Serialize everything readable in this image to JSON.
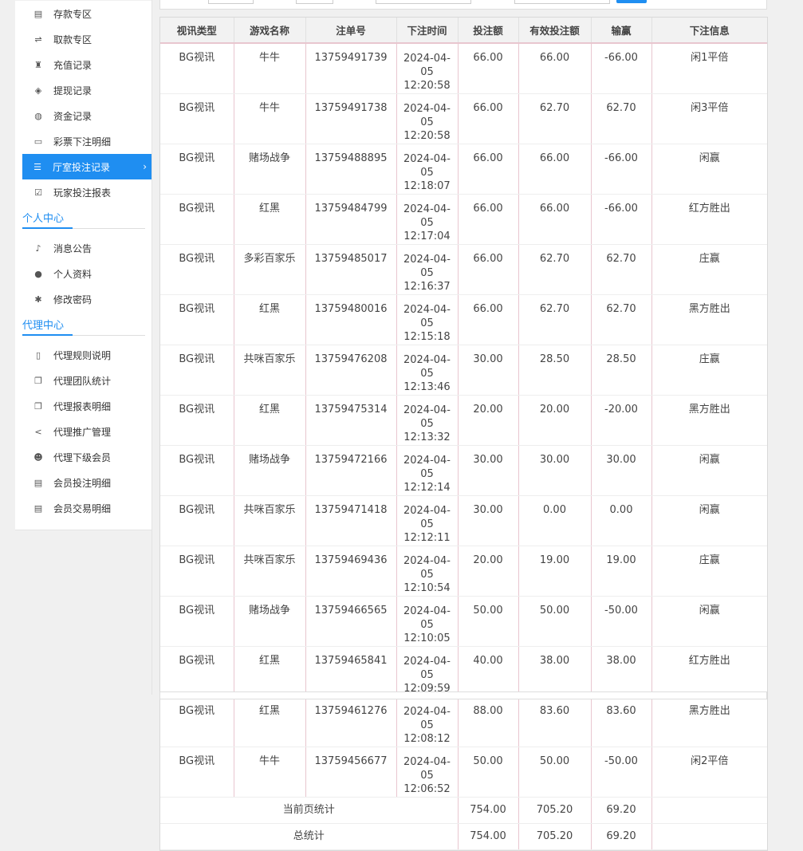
{
  "sidebar": {
    "groups": [
      {
        "title": "",
        "items": [
          {
            "label": "存款专区",
            "icon": "deposit-icon",
            "active": false
          },
          {
            "label": "取款专区",
            "icon": "withdraw-icon",
            "active": false
          },
          {
            "label": "充值记录",
            "icon": "moneybag-icon",
            "active": false
          },
          {
            "label": "提现记录",
            "icon": "tag-icon",
            "active": false
          },
          {
            "label": "资金记录",
            "icon": "funds-icon",
            "active": false
          },
          {
            "label": "彩票下注明细",
            "icon": "ticket-icon",
            "active": false
          },
          {
            "label": "厅室投注记录",
            "icon": "list-icon",
            "active": true
          },
          {
            "label": "玩家投注报表",
            "icon": "report-icon",
            "active": false
          }
        ]
      },
      {
        "title": "个人中心",
        "items": [
          {
            "label": "消息公告",
            "icon": "bell-icon",
            "active": false
          },
          {
            "label": "个人资料",
            "icon": "user-icon",
            "active": false
          },
          {
            "label": "修改密码",
            "icon": "gear-icon",
            "active": false
          }
        ]
      },
      {
        "title": "代理中心",
        "items": [
          {
            "label": "代理规则说明",
            "icon": "document-icon",
            "active": false
          },
          {
            "label": "代理团队统计",
            "icon": "copy-icon",
            "active": false
          },
          {
            "label": "代理报表明细",
            "icon": "copy-icon",
            "active": false
          },
          {
            "label": "代理推广管理",
            "icon": "share-icon",
            "active": false
          },
          {
            "label": "代理下级会员",
            "icon": "users-icon",
            "active": false
          },
          {
            "label": "会员投注明细",
            "icon": "doclist-icon",
            "active": false
          },
          {
            "label": "会员交易明细",
            "icon": "doclist-icon",
            "active": false
          }
        ]
      }
    ],
    "active_arrow": "›"
  },
  "table": {
    "headers": [
      "视讯类型",
      "游戏名称",
      "注单号",
      "下注时间",
      "投注额",
      "有效投注额",
      "输赢",
      "下注信息"
    ],
    "rows": [
      [
        "BG视讯",
        "牛牛",
        "13759491739",
        "2024-04-05",
        "12:20:58",
        "66.00",
        "66.00",
        "-66.00",
        "闲1平倍"
      ],
      [
        "BG视讯",
        "牛牛",
        "13759491738",
        "2024-04-05",
        "12:20:58",
        "66.00",
        "62.70",
        "62.70",
        "闲3平倍"
      ],
      [
        "BG视讯",
        "赌场战争",
        "13759488895",
        "2024-04-05",
        "12:18:07",
        "66.00",
        "66.00",
        "-66.00",
        "闲赢"
      ],
      [
        "BG视讯",
        "红黑",
        "13759484799",
        "2024-04-05",
        "12:17:04",
        "66.00",
        "66.00",
        "-66.00",
        "红方胜出"
      ],
      [
        "BG视讯",
        "多彩百家乐",
        "13759485017",
        "2024-04-05",
        "12:16:37",
        "66.00",
        "62.70",
        "62.70",
        "庄赢"
      ],
      [
        "BG视讯",
        "红黑",
        "13759480016",
        "2024-04-05",
        "12:15:18",
        "66.00",
        "62.70",
        "62.70",
        "黑方胜出"
      ],
      [
        "BG视讯",
        "共咪百家乐",
        "13759476208",
        "2024-04-05",
        "12:13:46",
        "30.00",
        "28.50",
        "28.50",
        "庄赢"
      ],
      [
        "BG视讯",
        "红黑",
        "13759475314",
        "2024-04-05",
        "12:13:32",
        "20.00",
        "20.00",
        "-20.00",
        "黑方胜出"
      ],
      [
        "BG视讯",
        "赌场战争",
        "13759472166",
        "2024-04-05",
        "12:12:14",
        "30.00",
        "30.00",
        "30.00",
        "闲赢"
      ],
      [
        "BG视讯",
        "共咪百家乐",
        "13759471418",
        "2024-04-05",
        "12:12:11",
        "30.00",
        "0.00",
        "0.00",
        "闲赢"
      ],
      [
        "BG视讯",
        "共咪百家乐",
        "13759469436",
        "2024-04-05",
        "12:10:54",
        "20.00",
        "19.00",
        "19.00",
        "庄赢"
      ],
      [
        "BG视讯",
        "赌场战争",
        "13759466565",
        "2024-04-05",
        "12:10:05",
        "50.00",
        "50.00",
        "-50.00",
        "闲赢"
      ],
      [
        "BG视讯",
        "红黑",
        "13759465841",
        "2024-04-05",
        "12:09:59",
        "40.00",
        "38.00",
        "38.00",
        "红方胜出"
      ],
      [
        "BG视讯",
        "红黑",
        "13759461276",
        "2024-04-05",
        "12:08:12",
        "88.00",
        "83.60",
        "83.60",
        "黑方胜出"
      ],
      [
        "BG视讯",
        "牛牛",
        "13759456677",
        "2024-04-05",
        "12:06:52",
        "50.00",
        "50.00",
        "-50.00",
        "闲2平倍"
      ]
    ],
    "summaries": [
      {
        "label": "当前页统计",
        "bet": "754.00",
        "valid": "705.20",
        "win": "69.20"
      },
      {
        "label": "总统计",
        "bet": "754.00",
        "valid": "705.20",
        "win": "69.20"
      }
    ]
  },
  "colors": {
    "accent": "#1f8ef1",
    "header_bg": "#f2f2f2",
    "row_border": "#e8c6cf"
  }
}
